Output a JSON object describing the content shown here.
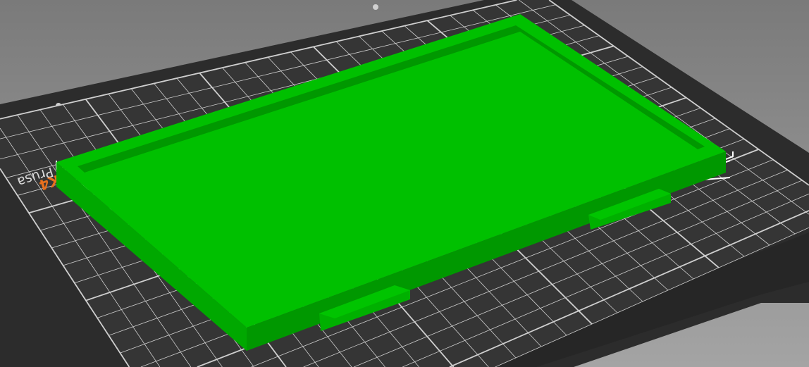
{
  "viewport": {
    "bed": {
      "logo_text": "by Josef Prusa",
      "model_text": "K4"
    },
    "colors": {
      "background": "#8c8c8c",
      "bed": "#343434",
      "bed_frame": "#2a2a2a",
      "grid": "#d0d0d0",
      "model_top": "#00c000",
      "model_side": "#009a00",
      "model_recess": "#00a800",
      "logo": "#e8701e"
    }
  }
}
